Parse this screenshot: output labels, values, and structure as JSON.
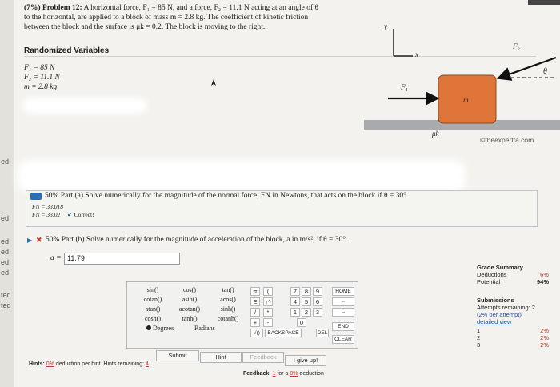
{
  "problem": {
    "number_label": "(7%) Problem 12:",
    "statement_1": "A horizontal force, F",
    "statement_line1": "A horizontal force, F₁ = 85 N, and a force, F₂ = 11.1 N acting at an angle of θ",
    "statement_line2": "to the horizontal, are applied to a block of mass m = 2.8 kg. The coefficient of kinetic friction",
    "statement_line3": "between the block and the surface is μk = 0.2. The block is moving to the right."
  },
  "random_vars": {
    "title": "Randomized Variables",
    "f1": "F₁ = 85 N",
    "f2": "F₂ = 11.1 N",
    "m": "m = 2.8 kg"
  },
  "diagram": {
    "y_label": "y",
    "x_label": "x",
    "f1_label": "F₁",
    "f2_label": "F₂",
    "theta_label": "θ",
    "mass_label": "m",
    "mu_label": "μk",
    "watermark": "©theexpertta.com"
  },
  "part_a": {
    "title": "50% Part (a) Solve numerically for the magnitude of the normal force, FN in Newtons, that acts on the block if θ = 30°.",
    "line1": "FN = 33.018",
    "line2": "FN = 33.02",
    "status": "Correct!"
  },
  "part_b": {
    "title": "50% Part (b) Solve numerically for the magnitude of acceleration of the block, a in m/s², if θ = 30°.",
    "answer_label": "a =",
    "answer_value": "11.79"
  },
  "grade": {
    "title": "Grade Summary",
    "deductions_label": "Deductions",
    "deductions_value": "6%",
    "potential_label": "Potential",
    "potential_value": "94%",
    "submissions_title": "Submissions",
    "attempts_label": "Attempts remaining: 2",
    "per_attempt": "(2% per attempt)",
    "detailed_view": "detailed view",
    "rows": [
      {
        "num": "1",
        "val": "2%"
      },
      {
        "num": "2",
        "val": "2%"
      },
      {
        "num": "3",
        "val": "2%"
      }
    ]
  },
  "calculator": {
    "functions": [
      [
        "sin()",
        "cos()",
        "tan()"
      ],
      [
        "cotan()",
        "asin()",
        "acos()"
      ],
      [
        "atan()",
        "acotan()",
        "sinh()"
      ],
      [
        "cosh()",
        "tanh()",
        "cotanh()"
      ]
    ],
    "degrees_label": "Degrees",
    "radians_label": "Radians",
    "symbols_col1": [
      "π",
      "E",
      "/",
      "+",
      "√()"
    ],
    "symbols_col2": [
      "(",
      "↑^",
      "*",
      "-",
      "0"
    ],
    "digits": [
      [
        "7",
        "8",
        "9"
      ],
      [
        "4",
        "5",
        "6"
      ],
      [
        "1",
        "2",
        "3"
      ]
    ],
    "zero": "0",
    "home": "HOME",
    "end": "END",
    "backspace": "BACKSPACE",
    "del": "DEL",
    "clear": "CLEAR",
    "arrow_left": "←",
    "arrow_right": "→"
  },
  "buttons": {
    "submit": "Submit",
    "hint": "Hint",
    "feedback": "Feedback",
    "give_up": "I give up!"
  },
  "footer": {
    "hints_label": "Hints:",
    "hints_pct": "0%",
    "hints_text": "deduction per hint. Hints remaining:",
    "hints_remaining": "4",
    "feedback_label": "Feedback:",
    "feedback_num": "1",
    "feedback_for": "for a",
    "feedback_pct": "0%",
    "feedback_deduction": "deduction"
  },
  "sidebar_fragments": [
    "ed",
    "ed",
    "ed",
    "ed",
    "ed",
    "ed",
    "ted",
    "ted"
  ]
}
